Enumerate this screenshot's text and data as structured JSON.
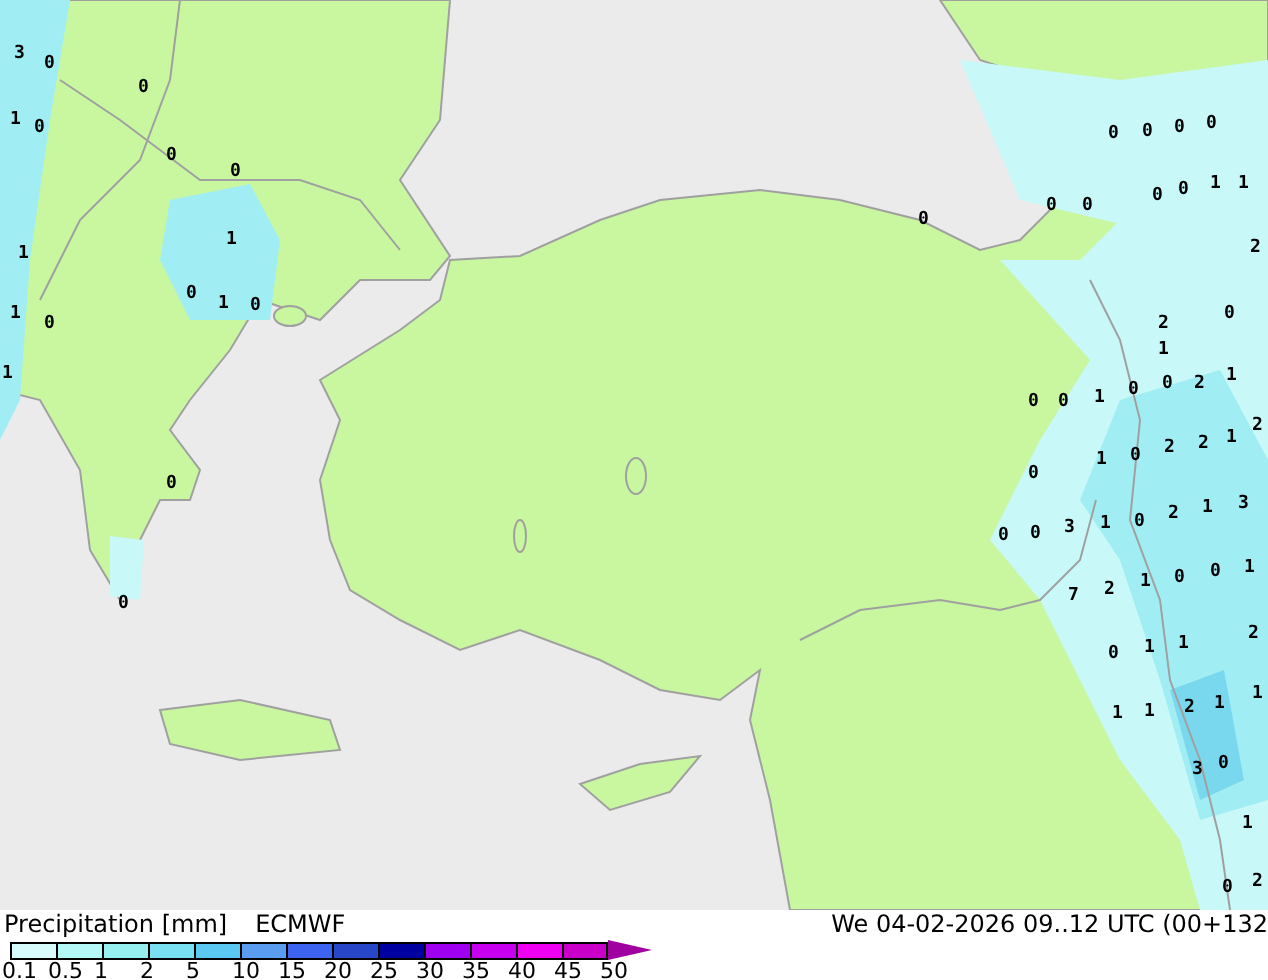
{
  "map": {
    "value_labels": [
      "3",
      "0",
      "0",
      "1",
      "0",
      "0",
      "0",
      "1",
      "1",
      "0",
      "1",
      "0",
      "1",
      "0",
      "1",
      "0",
      "0",
      "0",
      "0",
      "0",
      "0",
      "0",
      "0",
      "0",
      "0",
      "0",
      "1",
      "1",
      "2",
      "2",
      "0",
      "1",
      "2",
      "1",
      "0",
      "0",
      "1",
      "0",
      "0",
      "2",
      "2",
      "1",
      "2",
      "1",
      "0",
      "0",
      "0",
      "0",
      "3",
      "1",
      "0",
      "2",
      "1",
      "3",
      "7",
      "2",
      "1",
      "0",
      "0",
      "1",
      "0",
      "1",
      "1",
      "2",
      "1",
      "1",
      "2",
      "1",
      "1",
      "3",
      "0",
      "1",
      "0",
      "2"
    ]
  },
  "legend": {
    "title": "Precipitation [mm]",
    "model": "ECMWF",
    "valid_time": "We 04-02-2026 09..12 UTC (00+132",
    "scale": [
      {
        "label": "0.1",
        "color": "#d8fcfc",
        "kind": "segment"
      },
      {
        "label": "0.5",
        "color": "#b4f8f8",
        "kind": "segment"
      },
      {
        "label": "1",
        "color": "#96f0f0",
        "kind": "segment"
      },
      {
        "label": "2",
        "color": "#78e0f0",
        "kind": "segment"
      },
      {
        "label": "5",
        "color": "#5ac8f0",
        "kind": "segment"
      },
      {
        "label": "10",
        "color": "#5a9cf0",
        "kind": "segment"
      },
      {
        "label": "15",
        "color": "#3c64f0",
        "kind": "segment"
      },
      {
        "label": "20",
        "color": "#2846c8",
        "kind": "segment"
      },
      {
        "label": "25",
        "color": "#0000a0",
        "kind": "segment"
      },
      {
        "label": "30",
        "color": "#a000f0",
        "kind": "segment"
      },
      {
        "label": "35",
        "color": "#c800f0",
        "kind": "segment"
      },
      {
        "label": "40",
        "color": "#f000f0",
        "kind": "segment"
      },
      {
        "label": "45",
        "color": "#c800c8",
        "kind": "segment"
      },
      {
        "label": "50",
        "color": "#a000a0",
        "kind": "arrow"
      }
    ]
  }
}
